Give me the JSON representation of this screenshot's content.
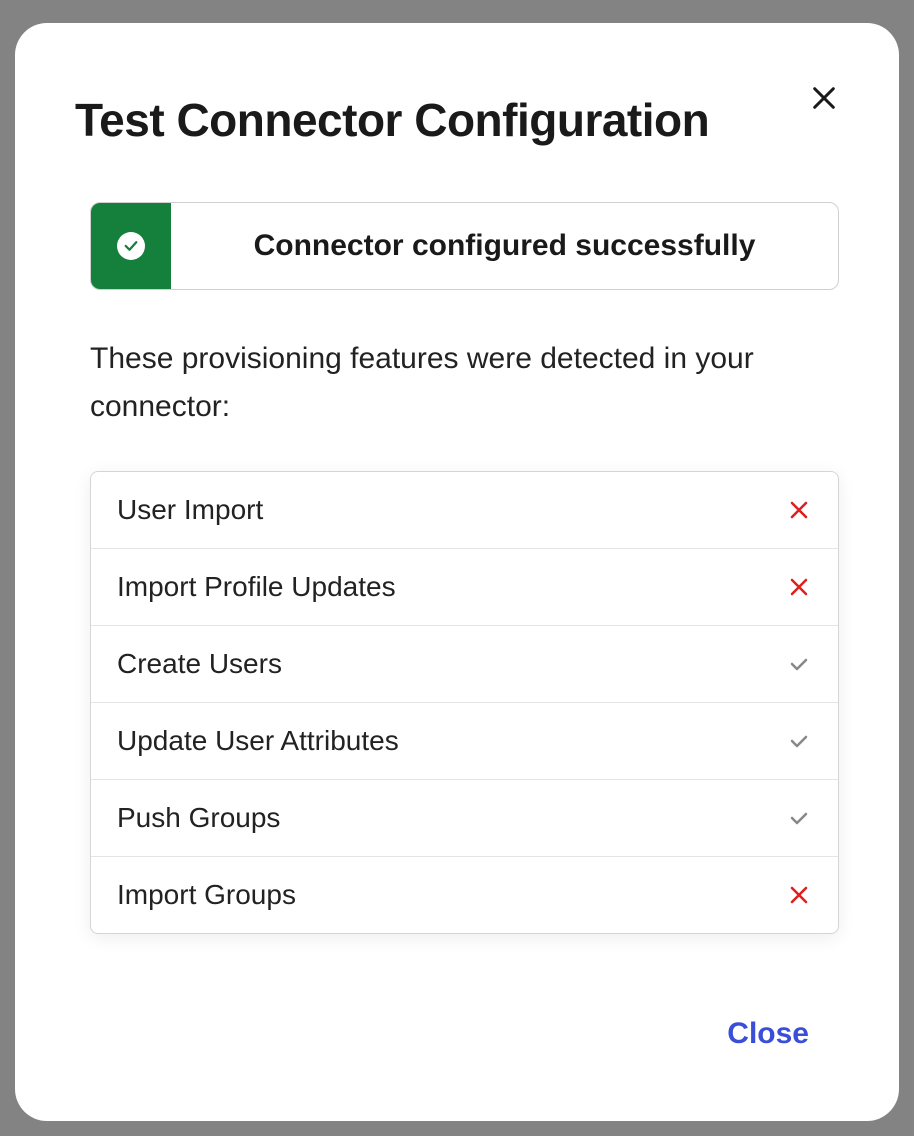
{
  "modal": {
    "title": "Test Connector Configuration",
    "status_message": "Connector configured successfully",
    "description": "These provisioning features were detected in your connector:",
    "features": [
      {
        "label": "User Import",
        "supported": false
      },
      {
        "label": "Import Profile Updates",
        "supported": false
      },
      {
        "label": "Create Users",
        "supported": true
      },
      {
        "label": "Update User Attributes",
        "supported": true
      },
      {
        "label": "Push Groups",
        "supported": true
      },
      {
        "label": "Import Groups",
        "supported": false
      }
    ],
    "close_label": "Close"
  }
}
